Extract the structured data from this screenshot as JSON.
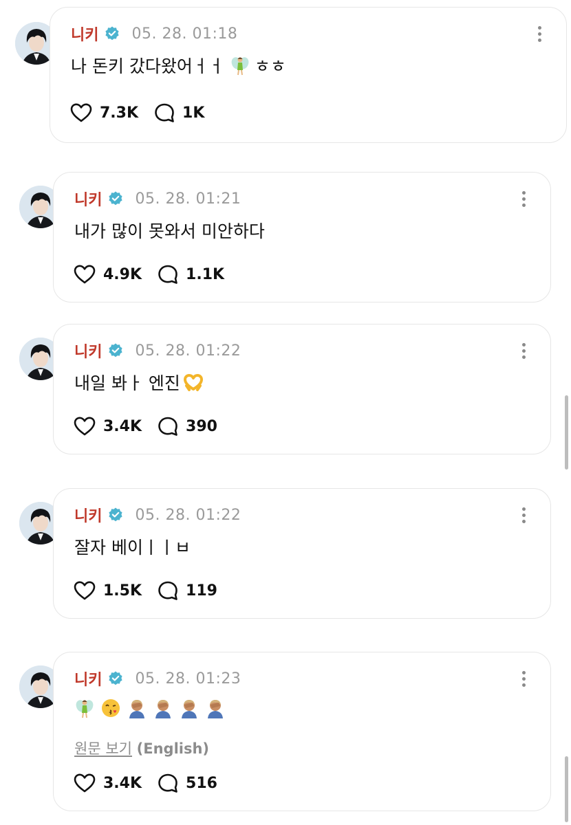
{
  "colors": {
    "author": "#c0392b",
    "verified": "#4bb3cf",
    "timestamp": "#9a9a9a",
    "text": "#111111",
    "border": "#e6e6e6"
  },
  "posts": [
    {
      "author": "니키",
      "verified_icon": "verified-check-icon",
      "timestamp": "05. 28. 01:18",
      "text_parts": [
        "나 돈키 갔다왔어ㅓㅓ",
        "ㅎㅎ"
      ],
      "emojis": [
        "fairy-emoji"
      ],
      "likes": "7.3K",
      "comments": "1K"
    },
    {
      "author": "니키",
      "verified_icon": "verified-check-icon",
      "timestamp": "05. 28. 01:21",
      "text_parts": [
        "내가 많이 못와서 미안하다"
      ],
      "emojis": [],
      "likes": "4.9K",
      "comments": "1.1K"
    },
    {
      "author": "니키",
      "verified_icon": "verified-check-icon",
      "timestamp": "05. 28. 01:22",
      "text_parts": [
        "내일 봐ㅏ 엔진"
      ],
      "emojis": [
        "heart-hands-emoji"
      ],
      "likes": "3.4K",
      "comments": "390"
    },
    {
      "author": "니키",
      "verified_icon": "verified-check-icon",
      "timestamp": "05. 28. 01:22",
      "text_parts": [
        "잘자 베이ㅣㅣㅂ"
      ],
      "emojis": [],
      "likes": "1.5K",
      "comments": "119"
    },
    {
      "author": "니키",
      "verified_icon": "verified-check-icon",
      "timestamp": "05. 28. 01:23",
      "text_parts": [],
      "emojis": [
        "fairy-emoji",
        "kissing-face-emoji",
        "facepalm-emoji",
        "facepalm-emoji",
        "facepalm-emoji",
        "facepalm-emoji"
      ],
      "translate_link": "원문 보기",
      "translate_lang": "(English)",
      "likes": "3.4K",
      "comments": "516"
    }
  ],
  "icons": {
    "like": "heart-icon",
    "comment": "comment-bubble-icon",
    "more": "more-options-icon"
  }
}
